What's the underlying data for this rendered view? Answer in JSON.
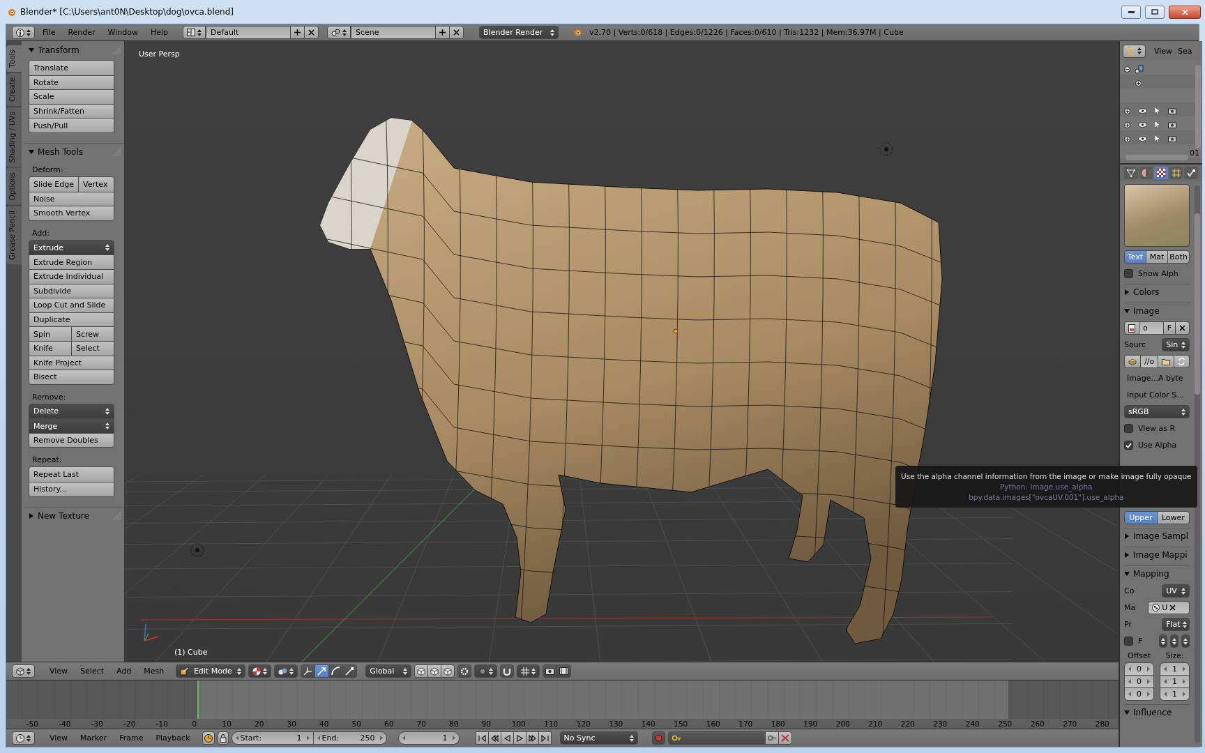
{
  "window": {
    "title": "Blender* [C:\\Users\\ant0N\\Desktop\\dog\\ovca.blend]"
  },
  "info_header": {
    "menus": [
      "File",
      "Render",
      "Window",
      "Help"
    ],
    "screen_layout": "Default",
    "scene": "Scene",
    "render_engine": "Blender Render",
    "stats": "v2.70 | Verts:0/618 | Edges:0/1226 | Faces:0/610 | Tris:1232 | Mem:36.97M | Cube"
  },
  "toolshelf": {
    "tabs": [
      {
        "label": "Tools",
        "selected": true
      },
      {
        "label": "Create",
        "selected": false
      },
      {
        "label": "Shading / UVs",
        "selected": false
      },
      {
        "label": "Options",
        "selected": false
      },
      {
        "label": "Grease Pencil",
        "selected": false
      }
    ],
    "panels": [
      {
        "title": "Transform",
        "expanded": true,
        "sections": [
          {
            "rows": [
              {
                "kind": "button",
                "labels": [
                  "Translate"
                ]
              },
              {
                "kind": "button",
                "labels": [
                  "Rotate"
                ]
              },
              {
                "kind": "button",
                "labels": [
                  "Scale"
                ]
              },
              {
                "kind": "button",
                "labels": [
                  "Shrink/Fatten"
                ]
              },
              {
                "kind": "button",
                "labels": [
                  "Push/Pull"
                ]
              }
            ]
          }
        ]
      },
      {
        "title": "Mesh Tools",
        "expanded": true,
        "sections": [
          {
            "heading": "Deform:",
            "rows": [
              {
                "kind": "button",
                "labels": [
                  "Slide Edge",
                  "Vertex"
                ]
              },
              {
                "kind": "button",
                "labels": [
                  "Noise"
                ]
              },
              {
                "kind": "button",
                "labels": [
                  "Smooth Vertex"
                ]
              }
            ]
          },
          {
            "heading": "Add:",
            "rows": [
              {
                "kind": "menu",
                "labels": [
                  "Extrude"
                ]
              },
              {
                "kind": "button",
                "labels": [
                  "Extrude Region"
                ]
              },
              {
                "kind": "button",
                "labels": [
                  "Extrude Individual"
                ]
              },
              {
                "kind": "button",
                "labels": [
                  "Subdivide"
                ]
              },
              {
                "kind": "button",
                "labels": [
                  "Loop Cut and Slide"
                ]
              },
              {
                "kind": "button",
                "labels": [
                  "Duplicate"
                ]
              },
              {
                "kind": "button",
                "labels": [
                  "Spin",
                  "Screw"
                ]
              },
              {
                "kind": "button",
                "labels": [
                  "Knife",
                  "Select"
                ]
              },
              {
                "kind": "button",
                "labels": [
                  "Knife Project"
                ]
              },
              {
                "kind": "button",
                "labels": [
                  "Bisect"
                ]
              }
            ]
          },
          {
            "heading": "Remove:",
            "rows": [
              {
                "kind": "menu",
                "labels": [
                  "Delete"
                ]
              },
              {
                "kind": "menu",
                "labels": [
                  "Merge"
                ]
              },
              {
                "kind": "button",
                "labels": [
                  "Remove Doubles"
                ]
              }
            ]
          },
          {
            "heading": "Repeat:",
            "rows": [
              {
                "kind": "button",
                "labels": [
                  "Repeat Last"
                ]
              },
              {
                "kind": "button",
                "labels": [
                  "History..."
                ]
              }
            ]
          }
        ]
      },
      {
        "title": "New Texture",
        "expanded": false
      }
    ]
  },
  "viewport": {
    "view_name": "User Persp",
    "object_label": "(1) Cube"
  },
  "outliner": {
    "menus": [
      "View",
      "Sea"
    ],
    "row_suffix": "01"
  },
  "properties": {
    "context_tabs": [
      {
        "kind": "mesh",
        "selected": false
      },
      {
        "kind": "material",
        "selected": false
      },
      {
        "kind": "texture",
        "selected": true
      },
      {
        "kind": "particles",
        "selected": false
      },
      {
        "kind": "physics",
        "selected": false
      }
    ],
    "preview_modes": [
      {
        "label": "Text",
        "selected": true
      },
      {
        "label": "Mat",
        "selected": false
      },
      {
        "label": "Both",
        "selected": false
      }
    ],
    "show_alpha": {
      "label": "Show Alph",
      "checked": false
    },
    "panels": [
      {
        "title": "Colors",
        "expanded": false
      },
      {
        "title": "Image",
        "expanded": true,
        "rows": [
          {
            "kind": "image_selector",
            "texts": [
              "o",
              "F"
            ]
          },
          {
            "kind": "dropdown",
            "label": "Sourc",
            "value": "Sin"
          },
          {
            "kind": "filepath",
            "value": "//o"
          },
          {
            "kind": "text",
            "label": "Image...A byte"
          },
          {
            "kind": "text",
            "label": "Input Color S..."
          },
          {
            "kind": "dropdown",
            "value": "sRGB"
          },
          {
            "kind": "checkbox",
            "label": "View as R",
            "checked": false
          },
          {
            "kind": "checkbox",
            "label": "Use Alpha",
            "checked": true
          },
          {
            "kind": "segmented",
            "options": [
              {
                "label": "Upper",
                "selected": true
              },
              {
                "label": "Lower",
                "selected": false
              }
            ]
          }
        ]
      },
      {
        "title": "Image Sampl",
        "expanded": false
      },
      {
        "title": "Image Mappi",
        "expanded": false
      },
      {
        "title": "Mapping",
        "expanded": true,
        "rows": [
          {
            "kind": "dropdown",
            "label": "Co",
            "value": "UV"
          },
          {
            "kind": "object_field",
            "label": "Ma",
            "value": "U"
          },
          {
            "kind": "dropdown",
            "label": "Pr",
            "value": "Flat"
          },
          {
            "kind": "axes",
            "label": "F",
            "checked": false
          },
          {
            "kind": "vectors",
            "columns": [
              {
                "label": "Offset",
                "values": [
                  "0",
                  "0",
                  "0"
                ]
              },
              {
                "label": "Size:",
                "values": [
                  "1",
                  "1",
                  "1"
                ]
              }
            ]
          }
        ]
      },
      {
        "title": "Influence",
        "expanded": true
      }
    ]
  },
  "tooltip": {
    "description": "Use the alpha channel information from the image or make image fully opaque",
    "python": "Python: Image.use_alpha",
    "path": "bpy.data.images[\"ovcaUV.001\"].use_alpha"
  },
  "view3d_header": {
    "menus": [
      "View",
      "Select",
      "Add",
      "Mesh"
    ],
    "mode": "Edit Mode",
    "manipulators": [
      {
        "kind": "toggle",
        "selected": false
      },
      {
        "kind": "translate",
        "selected": true
      },
      {
        "kind": "rotate",
        "selected": false
      },
      {
        "kind": "scale",
        "selected": false
      }
    ],
    "orientation": "Global"
  },
  "timeline": {
    "ruler": [
      "-50",
      "-40",
      "-30",
      "-20",
      "-10",
      "0",
      "10",
      "20",
      "30",
      "40",
      "50",
      "60",
      "70",
      "80",
      "90",
      "100",
      "110",
      "120",
      "130",
      "140",
      "150",
      "160",
      "170",
      "180",
      "190",
      "200",
      "210",
      "220",
      "230",
      "240",
      "250",
      "260",
      "270",
      "280"
    ]
  },
  "timeline_header": {
    "menus": [
      "View",
      "Marker",
      "Frame",
      "Playback"
    ],
    "start": {
      "label": "Start:",
      "value": "1"
    },
    "end": {
      "label": "End:",
      "value": "250"
    },
    "current_frame": "1",
    "sync": "No Sync"
  }
}
